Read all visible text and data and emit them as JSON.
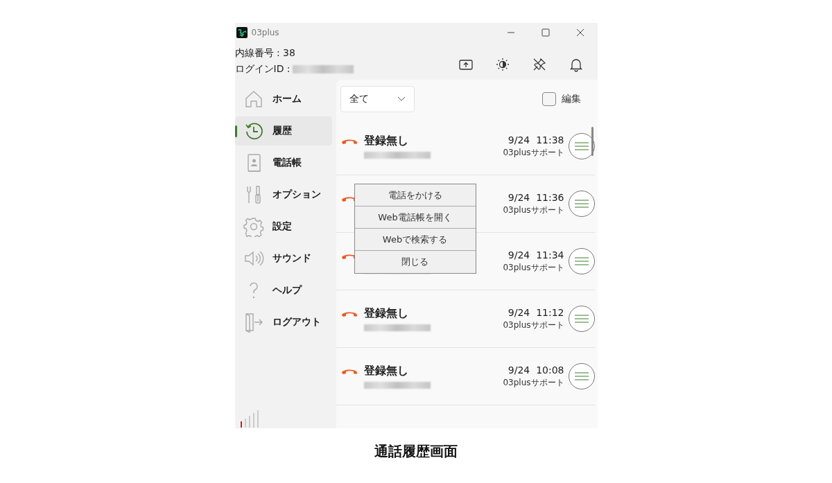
{
  "window": {
    "title": "03plus"
  },
  "account": {
    "extension": "内線番号 : 38",
    "login_label": "ログインID :"
  },
  "sidebar": {
    "items": [
      {
        "label": "ホーム",
        "selected": false
      },
      {
        "label": "履歴",
        "selected": true
      },
      {
        "label": "電話帳",
        "selected": false
      },
      {
        "label": "オプション",
        "selected": false
      },
      {
        "label": "設定",
        "selected": false
      },
      {
        "label": "サウンド",
        "selected": false
      },
      {
        "label": "ヘルプ",
        "selected": false
      },
      {
        "label": "ログアウト",
        "selected": false
      }
    ]
  },
  "filter": {
    "value": "全て"
  },
  "edit": {
    "label": "編集",
    "checked": false
  },
  "calls": [
    {
      "name": "登録無し",
      "time": "9/24  11:38",
      "caller": "03plusサポート",
      "missed": true
    },
    {
      "time": "9/24  11:36",
      "caller": "03plusサポート",
      "missed": true
    },
    {
      "time": "9/24  11:34",
      "caller": "03plusサポート",
      "missed": true
    },
    {
      "name": "登録無し",
      "time": "9/24  11:12",
      "caller": "03plusサポート",
      "missed": true
    },
    {
      "name": "登録無し",
      "time": "9/24  10:08",
      "caller": "03plusサポート",
      "missed": true
    }
  ],
  "context_menu": {
    "items": [
      "電話をかける",
      "Web電話帳を開く",
      "Webで検索する",
      "閉じる"
    ]
  },
  "caption": "通話履歴画面"
}
